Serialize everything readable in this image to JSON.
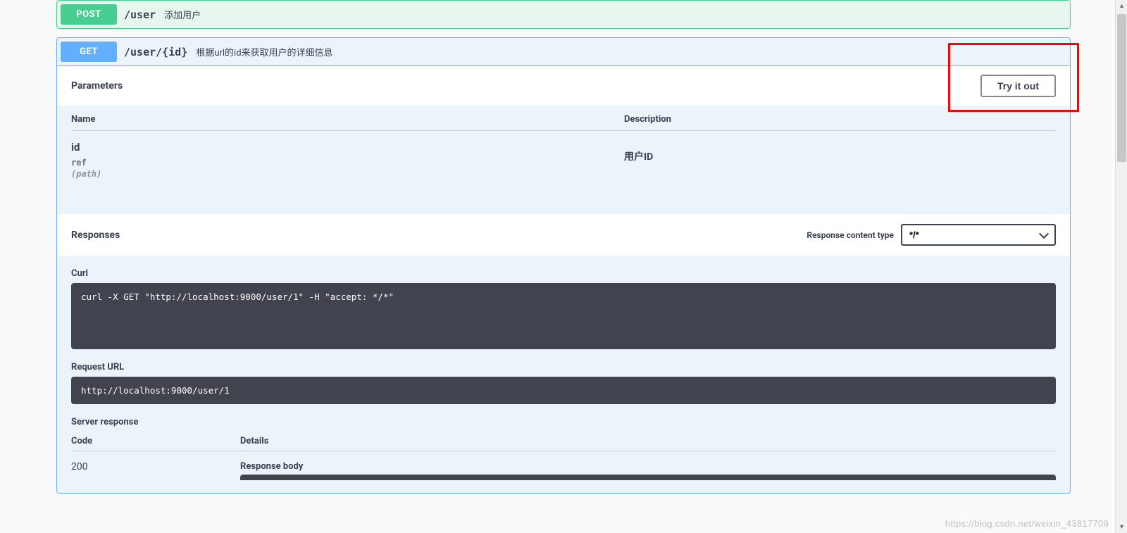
{
  "ops": {
    "post": {
      "method": "POST",
      "path": "/user",
      "summary": "添加用户"
    },
    "get": {
      "method": "GET",
      "path": "/user/{id}",
      "summary": "根据url的id来获取用户的详细信息"
    }
  },
  "parameters": {
    "heading": "Parameters",
    "try_label": "Try it out",
    "cols": {
      "name": "Name",
      "desc": "Description"
    },
    "rows": [
      {
        "name": "id",
        "type": "ref",
        "in": "(path)",
        "desc": "用户ID"
      }
    ]
  },
  "responses": {
    "heading": "Responses",
    "content_type_label": "Response content type",
    "content_type_value": "*/*",
    "curl_label": "Curl",
    "curl_cmd": "curl -X GET \"http://localhost:9000/user/1\" -H \"accept: */*\"",
    "request_url_label": "Request URL",
    "request_url": "http://localhost:9000/user/1",
    "server_response_label": "Server response",
    "cols": {
      "code": "Code",
      "details": "Details"
    },
    "row": {
      "code": "200",
      "response_body_label": "Response body"
    }
  },
  "watermark": "https://blog.csdn.net/weixin_43817709"
}
